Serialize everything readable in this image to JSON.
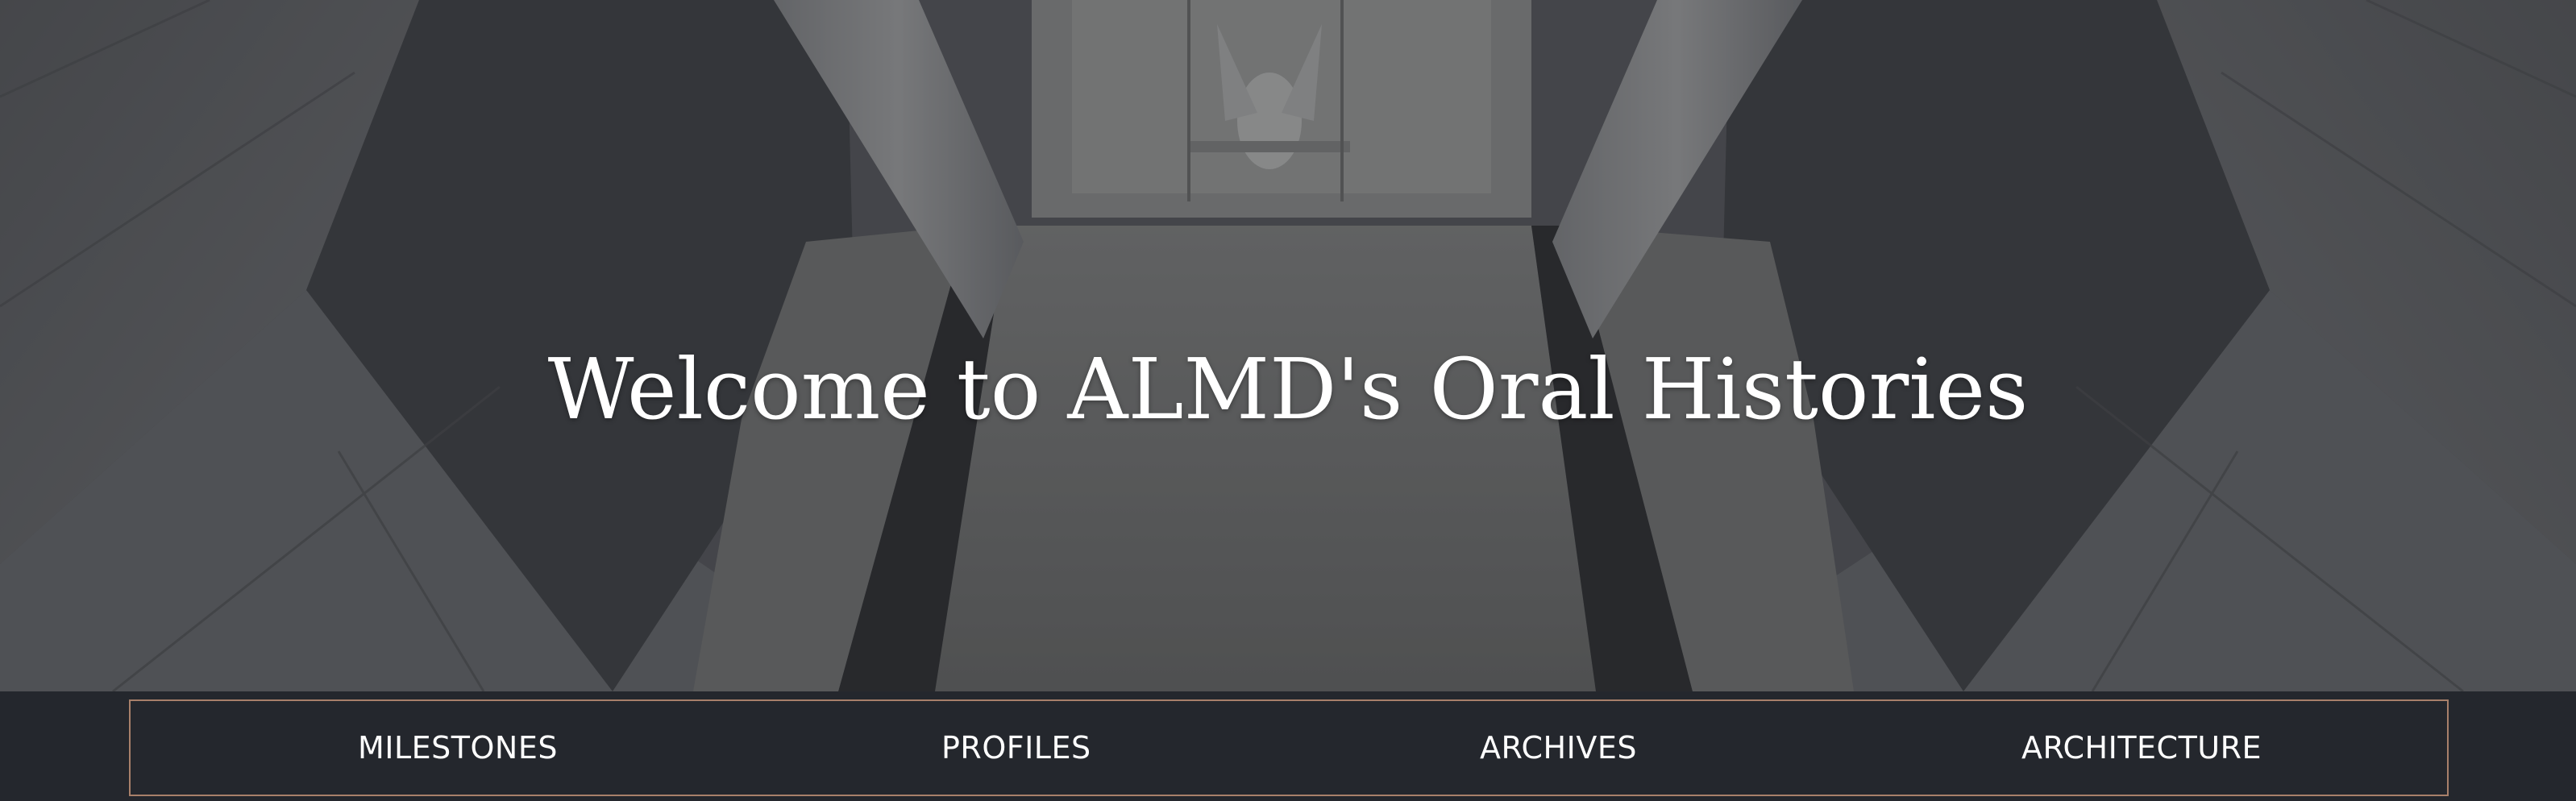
{
  "hero": {
    "title": "Welcome to ALMD's Oral Histories"
  },
  "nav": {
    "items": [
      {
        "label": "MILESTONES"
      },
      {
        "label": "PROFILES"
      },
      {
        "label": "ARCHIVES"
      },
      {
        "label": "ARCHITECTURE"
      }
    ]
  },
  "colors": {
    "nav_background": "#24272d",
    "nav_border": "#a8806a",
    "text": "#ffffff",
    "hero_overlay": "#3c3e44"
  }
}
